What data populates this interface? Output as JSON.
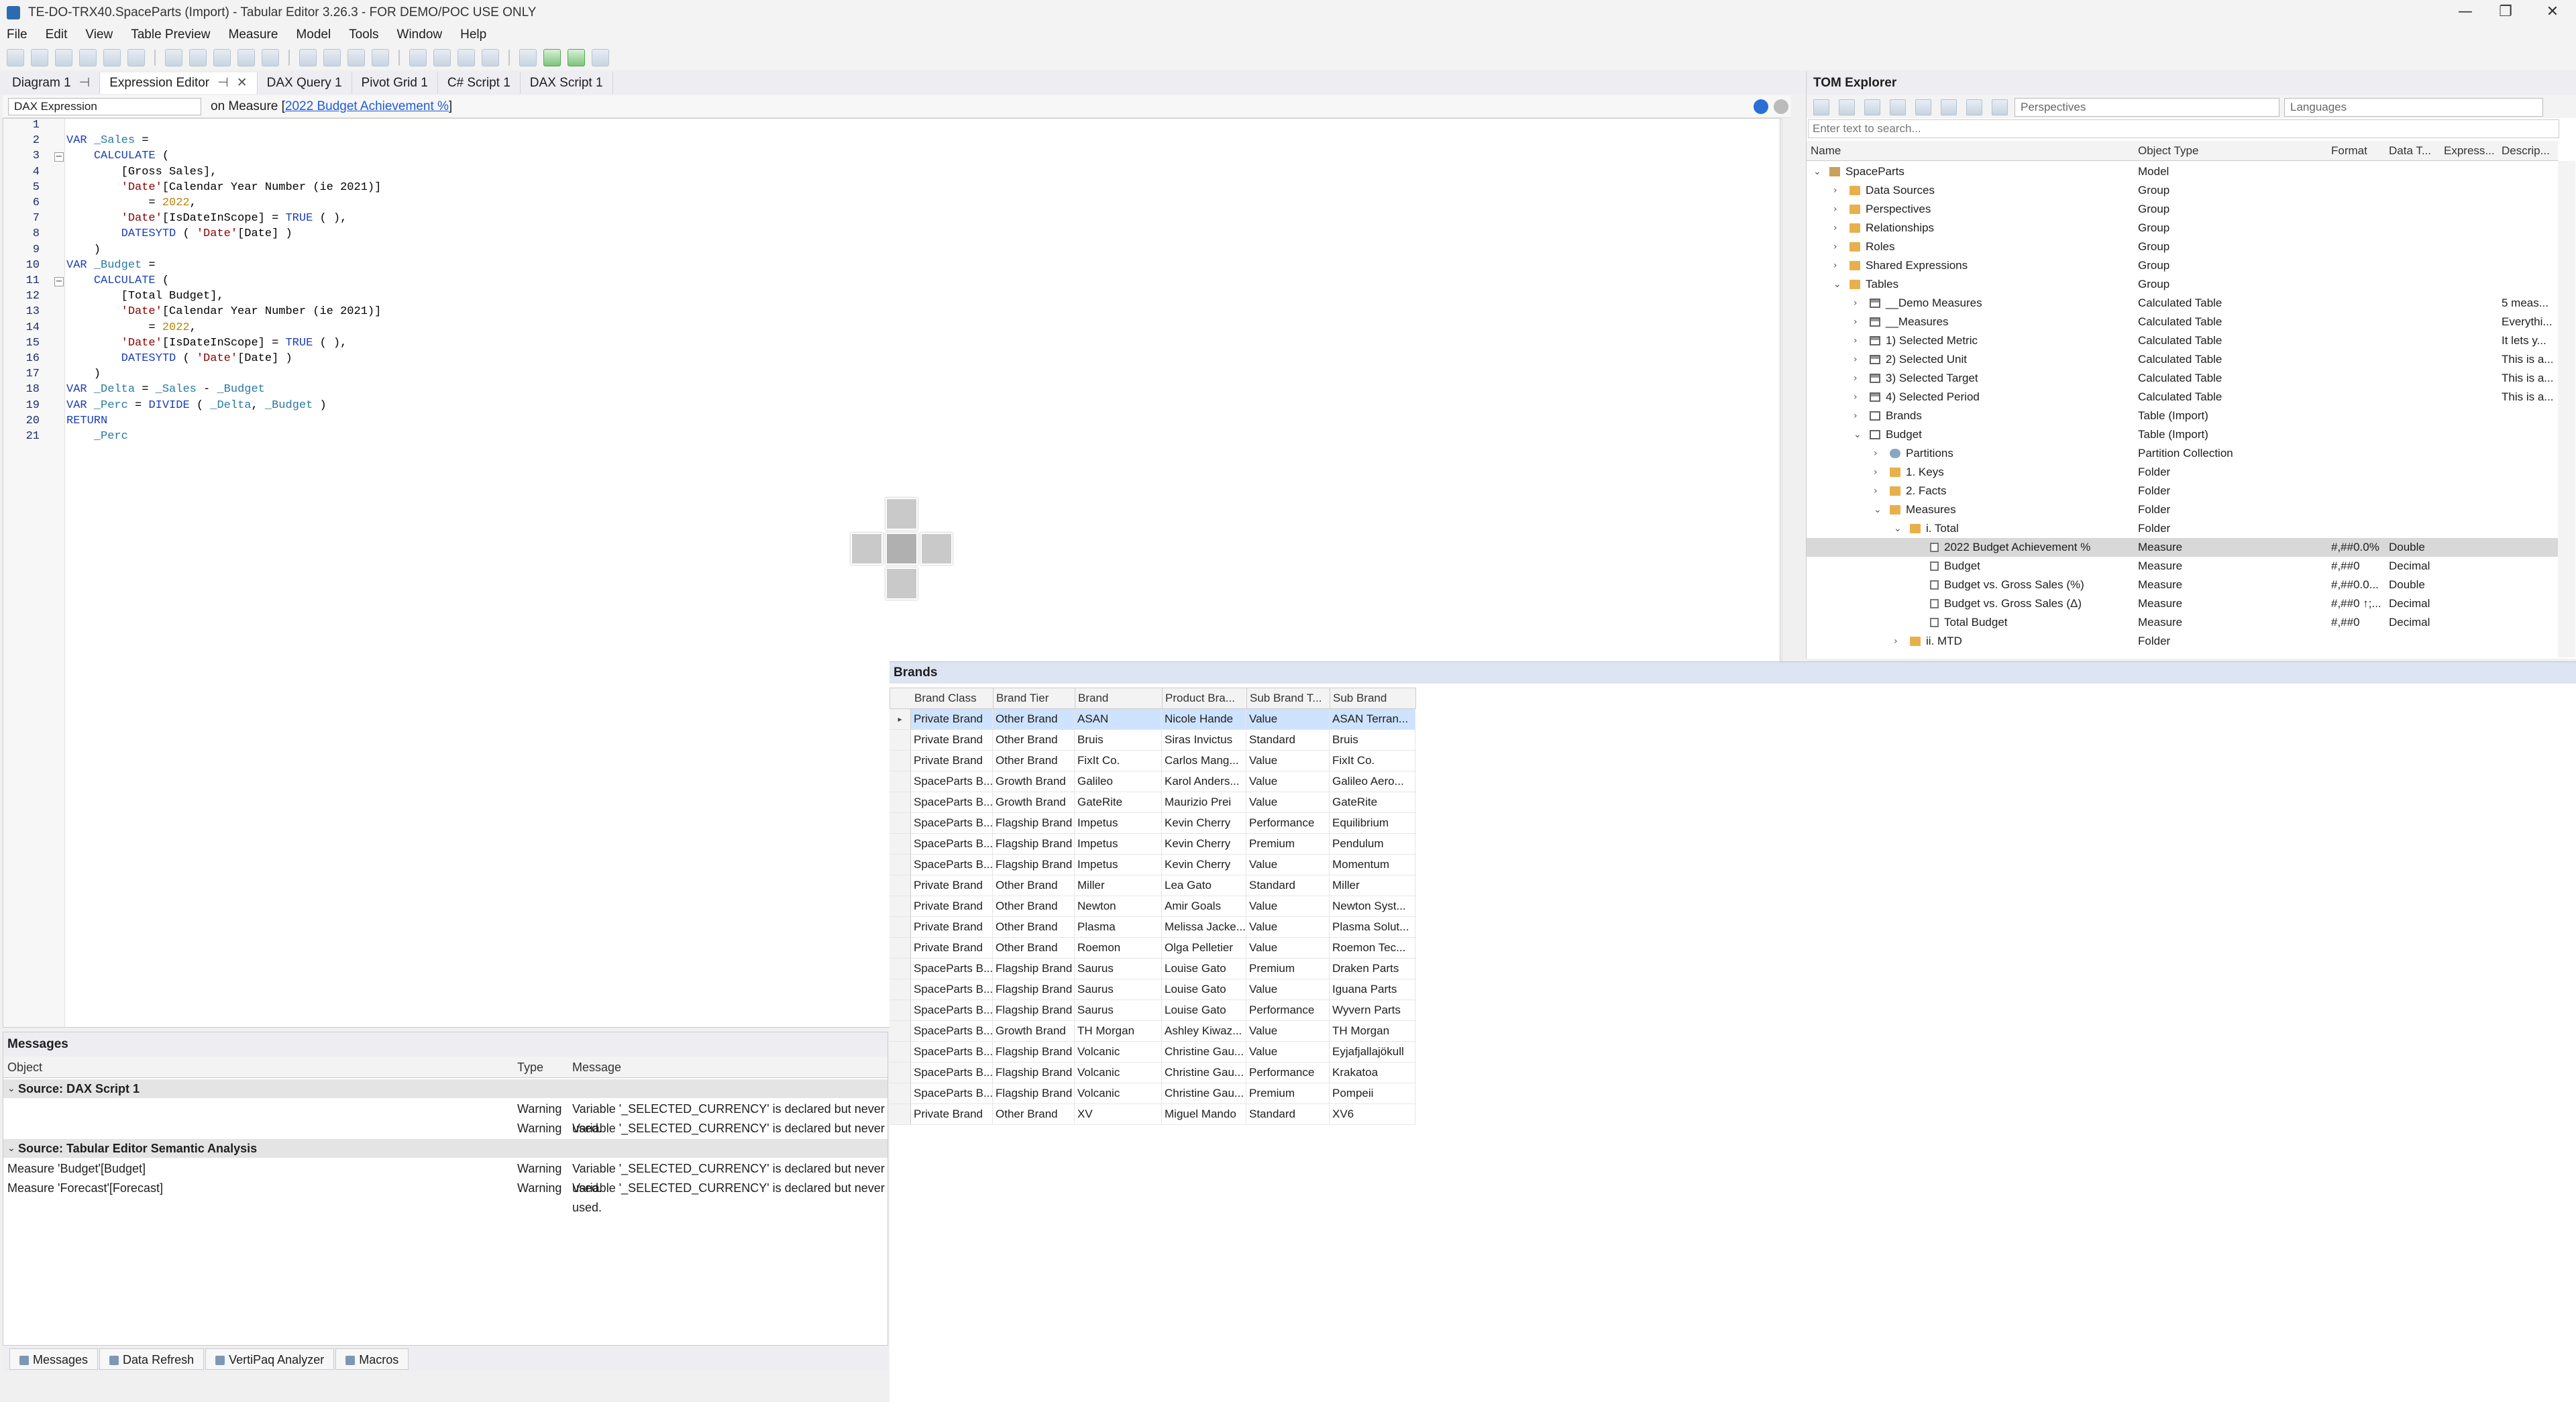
{
  "window": {
    "title": "TE-DO-TRX40.SpaceParts (Import) - Tabular Editor 3.26.3 - FOR DEMO/POC USE ONLY",
    "minimize": "—",
    "maximize": "❐",
    "close": "✕"
  },
  "menu": [
    "File",
    "Edit",
    "View",
    "Table Preview",
    "Measure",
    "Model",
    "Tools",
    "Window",
    "Help"
  ],
  "doc_tabs": [
    {
      "label": "Diagram 1",
      "pin": "⊣",
      "active": false
    },
    {
      "label": "Expression Editor",
      "pin": "⊣",
      "close": "✕",
      "active": true
    },
    {
      "label": "DAX Query 1",
      "active": false
    },
    {
      "label": "Pivot Grid 1",
      "active": false
    },
    {
      "label": "C# Script 1",
      "active": false
    },
    {
      "label": "DAX Script 1",
      "active": false
    }
  ],
  "editor": {
    "property_selector": "DAX Expression",
    "on_measure_prefix": "on Measure [",
    "on_measure_link": "2022 Budget Achievement %",
    "on_measure_suffix": "]",
    "lines": [
      "",
      "VAR _Sales =",
      "    CALCULATE (",
      "        [Gross Sales],",
      "        'Date'[Calendar Year Number (ie 2021)]",
      "            = 2022,",
      "        'Date'[IsDateInScope] = TRUE ( ),",
      "        DATESYTD ( 'Date'[Date] )",
      "    )",
      "VAR _Budget =",
      "    CALCULATE (",
      "        [Total Budget],",
      "        'Date'[Calendar Year Number (ie 2021)]",
      "            = 2022,",
      "        'Date'[IsDateInScope] = TRUE ( ),",
      "        DATESYTD ( 'Date'[Date] )",
      "    )",
      "VAR _Delta = _Sales - _Budget",
      "VAR _Perc = DIVIDE ( _Delta, _Budget )",
      "RETURN",
      "    _Perc"
    ],
    "line_numbers": [
      "1",
      "2",
      "3",
      "4",
      "5",
      "6",
      "7",
      "8",
      "9",
      "10",
      "11",
      "12",
      "13",
      "14",
      "15",
      "16",
      "17",
      "18",
      "19",
      "20",
      "21"
    ]
  },
  "messages": {
    "title": "Messages",
    "columns": [
      "Object",
      "Type",
      "Message"
    ],
    "groups": [
      {
        "label": "Source: DAX Script 1",
        "rows": [
          {
            "object": "",
            "type": "Warning",
            "message": "Variable '_SELECTED_CURRENCY' is declared but never used."
          },
          {
            "object": "",
            "type": "Warning",
            "message": "Variable '_SELECTED_CURRENCY' is declared but never used."
          }
        ]
      },
      {
        "label": "Source: Tabular Editor Semantic Analysis",
        "rows": [
          {
            "object": "Measure 'Budget'[Budget]",
            "type": "Warning",
            "message": "Variable '_SELECTED_CURRENCY' is declared but never used."
          },
          {
            "object": "Measure 'Forecast'[Forecast]",
            "type": "Warning",
            "message": "Variable '_SELECTED_CURRENCY' is declared but never used."
          }
        ]
      }
    ]
  },
  "bottom_tabs": [
    "Messages",
    "Data Refresh",
    "VertiPaq Analyzer",
    "Macros"
  ],
  "tom": {
    "title": "TOM Explorer",
    "perspectives_placeholder": "Perspectives",
    "languages_placeholder": "Languages",
    "search_placeholder": "Enter text to search...",
    "columns": [
      "Name",
      "Object Type",
      "Format",
      "Data T...",
      "Express...",
      "Descrip..."
    ],
    "rows": [
      {
        "level": 0,
        "chev": "⌄",
        "icon": "model",
        "name": "SpaceParts",
        "type": "Model",
        "format": "",
        "dtype": "",
        "desc": ""
      },
      {
        "level": 1,
        "chev": "›",
        "icon": "folder",
        "name": "Data Sources",
        "type": "Group",
        "format": "",
        "dtype": "",
        "desc": ""
      },
      {
        "level": 1,
        "chev": "›",
        "icon": "folder",
        "name": "Perspectives",
        "type": "Group",
        "format": "",
        "dtype": "",
        "desc": ""
      },
      {
        "level": 1,
        "chev": "›",
        "icon": "folder",
        "name": "Relationships",
        "type": "Group",
        "format": "",
        "dtype": "",
        "desc": ""
      },
      {
        "level": 1,
        "chev": "›",
        "icon": "folder",
        "name": "Roles",
        "type": "Group",
        "format": "",
        "dtype": "",
        "desc": ""
      },
      {
        "level": 1,
        "chev": "›",
        "icon": "folder",
        "name": "Shared Expressions",
        "type": "Group",
        "format": "",
        "dtype": "",
        "desc": ""
      },
      {
        "level": 1,
        "chev": "⌄",
        "icon": "folder",
        "name": "Tables",
        "type": "Group",
        "format": "",
        "dtype": "",
        "desc": ""
      },
      {
        "level": 2,
        "chev": "›",
        "icon": "calc",
        "name": "__Demo Measures",
        "type": "Calculated Table",
        "format": "",
        "dtype": "",
        "desc": "5 meas..."
      },
      {
        "level": 2,
        "chev": "›",
        "icon": "calc",
        "name": "__Measures",
        "type": "Calculated Table",
        "format": "",
        "dtype": "",
        "desc": "Everythi..."
      },
      {
        "level": 2,
        "chev": "›",
        "icon": "calc",
        "name": "1) Selected Metric",
        "type": "Calculated Table",
        "format": "",
        "dtype": "",
        "desc": "It lets y..."
      },
      {
        "level": 2,
        "chev": "›",
        "icon": "calc",
        "name": "2) Selected Unit",
        "type": "Calculated Table",
        "format": "",
        "dtype": "",
        "desc": "This is a..."
      },
      {
        "level": 2,
        "chev": "›",
        "icon": "calc",
        "name": "3) Selected Target",
        "type": "Calculated Table",
        "format": "",
        "dtype": "",
        "desc": "This is a..."
      },
      {
        "level": 2,
        "chev": "›",
        "icon": "calc",
        "name": "4) Selected Period",
        "type": "Calculated Table",
        "format": "",
        "dtype": "",
        "desc": "This is a..."
      },
      {
        "level": 2,
        "chev": "›",
        "icon": "table",
        "name": "Brands",
        "type": "Table (Import)",
        "format": "",
        "dtype": "",
        "desc": ""
      },
      {
        "level": 2,
        "chev": "⌄",
        "icon": "table",
        "name": "Budget",
        "type": "Table (Import)",
        "format": "",
        "dtype": "",
        "desc": ""
      },
      {
        "level": 3,
        "chev": "›",
        "icon": "part",
        "name": "Partitions",
        "type": "Partition Collection",
        "format": "",
        "dtype": "",
        "desc": ""
      },
      {
        "level": 3,
        "chev": "›",
        "icon": "folder",
        "name": "1. Keys",
        "type": "Folder",
        "format": "",
        "dtype": "",
        "desc": ""
      },
      {
        "level": 3,
        "chev": "›",
        "icon": "folder",
        "name": "2. Facts",
        "type": "Folder",
        "format": "",
        "dtype": "",
        "desc": ""
      },
      {
        "level": 3,
        "chev": "⌄",
        "icon": "folder",
        "name": "Measures",
        "type": "Folder",
        "format": "",
        "dtype": "",
        "desc": ""
      },
      {
        "level": 4,
        "chev": "⌄",
        "icon": "folder",
        "name": "i. Total",
        "type": "Folder",
        "format": "",
        "dtype": "",
        "desc": ""
      },
      {
        "level": 5,
        "chev": "",
        "icon": "measure",
        "name": "2022 Budget Achievement %",
        "type": "Measure",
        "format": "#,##0.0%",
        "dtype": "Double",
        "desc": "",
        "selected": true
      },
      {
        "level": 5,
        "chev": "",
        "icon": "measure",
        "name": "Budget",
        "type": "Measure",
        "format": "#,##0",
        "dtype": "Decimal",
        "desc": ""
      },
      {
        "level": 5,
        "chev": "",
        "icon": "measure",
        "name": "Budget vs. Gross Sales (%)",
        "type": "Measure",
        "format": "#,##0.0...",
        "dtype": "Double",
        "desc": ""
      },
      {
        "level": 5,
        "chev": "",
        "icon": "measure",
        "name": "Budget vs. Gross Sales (Δ)",
        "type": "Measure",
        "format": "#,##0 ↑;...",
        "dtype": "Decimal",
        "desc": ""
      },
      {
        "level": 5,
        "chev": "",
        "icon": "measure",
        "name": "Total Budget",
        "type": "Measure",
        "format": "#,##0",
        "dtype": "Decimal",
        "desc": ""
      },
      {
        "level": 4,
        "chev": "›",
        "icon": "folder",
        "name": "ii. MTD",
        "type": "Folder",
        "format": "",
        "dtype": "",
        "desc": ""
      }
    ]
  },
  "brands": {
    "title": "Brands",
    "row_indicator": "▸",
    "columns": [
      "Brand Class",
      "Brand Tier",
      "Brand",
      "Product Bra...",
      "Sub Brand T...",
      "Sub Brand"
    ],
    "rows": [
      [
        "Private Brand",
        "Other Brand",
        "ASAN",
        "Nicole Hande",
        "Value",
        "ASAN Terran..."
      ],
      [
        "Private Brand",
        "Other Brand",
        "Bruis",
        "Siras Invictus",
        "Standard",
        "Bruis"
      ],
      [
        "Private Brand",
        "Other Brand",
        "FixIt Co.",
        "Carlos Mang...",
        "Value",
        "FixIt Co."
      ],
      [
        "SpaceParts B...",
        "Growth Brand",
        "Galileo",
        "Karol Anders...",
        "Value",
        "Galileo Aero..."
      ],
      [
        "SpaceParts B...",
        "Growth Brand",
        "GateRite",
        "Maurizio Prei",
        "Value",
        "GateRite"
      ],
      [
        "SpaceParts B...",
        "Flagship Brand",
        "Impetus",
        "Kevin Cherry",
        "Performance",
        "Equilibrium"
      ],
      [
        "SpaceParts B...",
        "Flagship Brand",
        "Impetus",
        "Kevin Cherry",
        "Premium",
        "Pendulum"
      ],
      [
        "SpaceParts B...",
        "Flagship Brand",
        "Impetus",
        "Kevin Cherry",
        "Value",
        "Momentum"
      ],
      [
        "Private Brand",
        "Other Brand",
        "Miller",
        "Lea Gato",
        "Standard",
        "Miller"
      ],
      [
        "Private Brand",
        "Other Brand",
        "Newton",
        "Amir Goals",
        "Value",
        "Newton Syst..."
      ],
      [
        "Private Brand",
        "Other Brand",
        "Plasma",
        "Melissa Jacke...",
        "Value",
        "Plasma Solut..."
      ],
      [
        "Private Brand",
        "Other Brand",
        "Roemon",
        "Olga Pelletier",
        "Value",
        "Roemon Tec..."
      ],
      [
        "SpaceParts B...",
        "Flagship Brand",
        "Saurus",
        "Louise Gato",
        "Premium",
        "Draken Parts"
      ],
      [
        "SpaceParts B...",
        "Flagship Brand",
        "Saurus",
        "Louise Gato",
        "Value",
        "Iguana Parts"
      ],
      [
        "SpaceParts B...",
        "Flagship Brand",
        "Saurus",
        "Louise Gato",
        "Performance",
        "Wyvern Parts"
      ],
      [
        "SpaceParts B...",
        "Growth Brand",
        "TH Morgan",
        "Ashley Kiwaz...",
        "Value",
        "TH Morgan"
      ],
      [
        "SpaceParts B...",
        "Flagship Brand",
        "Volcanic",
        "Christine Gau...",
        "Value",
        "Eyjafjallajökull"
      ],
      [
        "SpaceParts B...",
        "Flagship Brand",
        "Volcanic",
        "Christine Gau...",
        "Performance",
        "Krakatoa"
      ],
      [
        "SpaceParts B...",
        "Flagship Brand",
        "Volcanic",
        "Christine Gau...",
        "Premium",
        "Pompeii"
      ],
      [
        "Private Brand",
        "Other Brand",
        "XV",
        "Miguel Mando",
        "Standard",
        "XV6"
      ]
    ]
  }
}
